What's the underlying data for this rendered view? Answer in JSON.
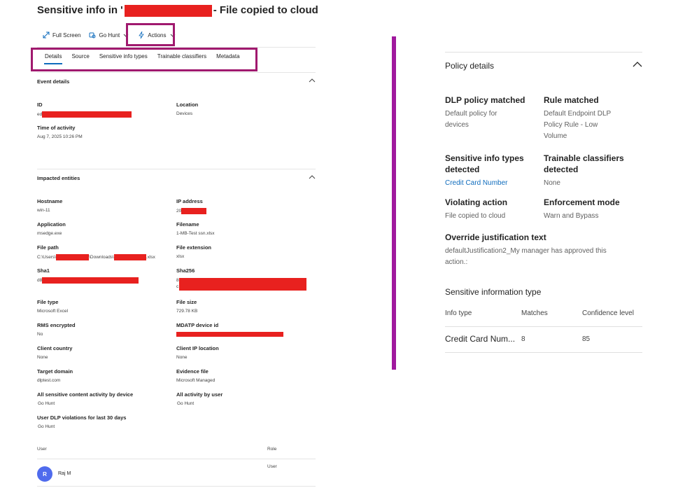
{
  "header": {
    "title_prefix": "Sensitive info in '",
    "title_suffix": "- File copied to cloud"
  },
  "toolbar": {
    "full_screen": "Full Screen",
    "go_hunt": "Go Hunt",
    "actions": "Actions"
  },
  "tabs": [
    "Details",
    "Source",
    "Sensitive info types",
    "Trainable classifiers",
    "Metadata"
  ],
  "event_details": {
    "title": "Event details",
    "id_label": "ID",
    "id_value": "ed",
    "location_label": "Location",
    "location_value": "Devices",
    "time_label": "Time of activity",
    "time_value": "Aug 7, 2025 10:26 PM"
  },
  "impacted": {
    "title": "Impacted entities",
    "hostname_label": "Hostname",
    "hostname_value": "win-11",
    "ip_label": "IP address",
    "ip_value": "20",
    "application_label": "Application",
    "application_value": "msedge.exe",
    "filename_label": "Filename",
    "filename_value": "1-MB-Test ssn.xlsx",
    "filepath_label": "File path",
    "filepath_a": "C:\\Users\\",
    "filepath_b": "\\Downloads\\",
    "filepath_c": ".xlsx",
    "fileext_label": "File extension",
    "fileext_value": "xlsx",
    "sha1_label": "Sha1",
    "sha1_value": "d8",
    "sha256_label": "Sha256",
    "sha256_a": "8",
    "sha256_b": "c",
    "filetype_label": "File type",
    "filetype_value": "Microsoft Excel",
    "filesize_label": "File size",
    "filesize_value": "729.78 KB",
    "rms_label": "RMS encrypted",
    "rms_value": "No",
    "mdatp_label": "MDATP device id",
    "country_label": "Client country",
    "country_value": "None",
    "ipclient_label": "Client IP location",
    "ipclient_value": "None",
    "domain_label": "Target domain",
    "domain_value": "dlptest.com",
    "evidence_label": "Evidence file",
    "evidence_value": "Microsoft Managed",
    "allsens_label": "All sensitive content activity by device",
    "allsens_value": "Go Hunt",
    "allact_label": "All activity by user",
    "allact_value": "Go Hunt",
    "userdlp_label": "User DLP violations for last 30 days",
    "userdlp_value": "Go Hunt"
  },
  "users_table": {
    "col_user": "User",
    "col_role": "Role",
    "row_initial": "R",
    "row_name": "Raj M",
    "row_role": "User"
  },
  "policy": {
    "title": "Policy details",
    "dlp_label": "DLP policy matched",
    "dlp_value_1": "Default policy for",
    "dlp_value_2": "devices",
    "rule_label": "Rule matched",
    "rule_value_1": "Default Endpoint DLP",
    "rule_value_2": "Policy Rule - Low",
    "rule_value_3": "Volume",
    "sit_label_1": "Sensitive info types",
    "sit_label_2": "detected",
    "sit_value": "Credit Card Number",
    "tc_label_1": "Trainable classifiers",
    "tc_label_2": "detected",
    "tc_value": "None",
    "violating_label": "Violating action",
    "violating_value": "File copied to cloud",
    "enforcement_label": "Enforcement mode",
    "enforcement_value": "Warn and Bypass",
    "override_label": "Override justification text",
    "override_value_1": "defaultJustification2_My manager has approved this",
    "override_value_2": "action.:",
    "sit_section": "Sensitive information type",
    "col_info": "Info type",
    "col_matches": "Matches",
    "col_conf": "Confidence level",
    "row_info": "Credit Card Num...",
    "row_matches": "8",
    "row_conf": "85"
  },
  "colors": {
    "accent": "#0f6cbd",
    "highlight": "#a0196e",
    "redaction": "#e8211f",
    "avatar": "#4f6bed"
  }
}
